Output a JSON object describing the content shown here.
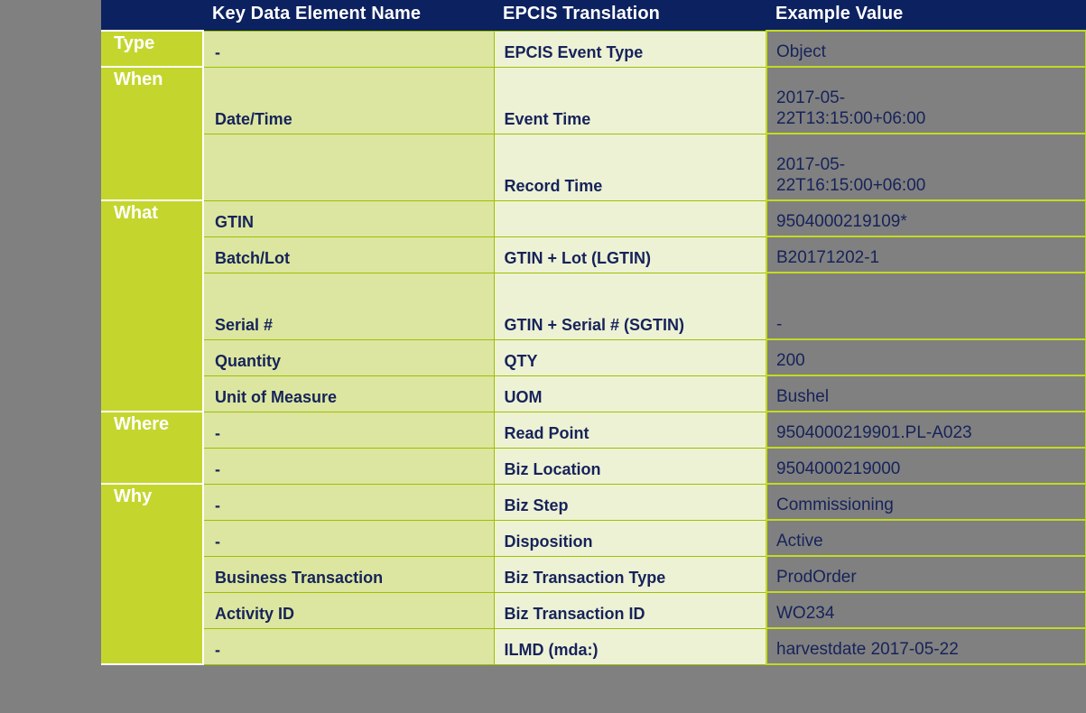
{
  "colors": {
    "page_background": "#808080",
    "header_background": "#0C2160",
    "header_text": "#FFFFFF",
    "section_background": "#C4D62E",
    "section_text": "#FFFFFF",
    "kde_background": "#DCE6A0",
    "epcis_background": "#EEF2D5",
    "body_text": "#16235A",
    "grid_line": "#9EC000",
    "value_border": "#C3DB1F"
  },
  "table": {
    "headers": {
      "section": "",
      "kde": "Key Data Element Name",
      "epcis": "EPCIS Translation",
      "value": "Example Value"
    },
    "sections": [
      {
        "label": "Type",
        "rowspan": 1
      },
      {
        "label": "When",
        "rowspan": 2
      },
      {
        "label": "What",
        "rowspan": 5
      },
      {
        "label": "Where",
        "rowspan": 2
      },
      {
        "label": "Why",
        "rowspan": 5
      }
    ],
    "rows": [
      {
        "section": "Type",
        "kde": "-",
        "epcis": "EPCIS Event Type",
        "value": "Object"
      },
      {
        "section": "When",
        "kde": "Date/Time",
        "epcis": "Event Time",
        "value": "2017-05-\n22T13:15:00+06:00"
      },
      {
        "section": "When",
        "kde": "",
        "epcis": "Record Time",
        "value": "2017-05-\n22T16:15:00+06:00"
      },
      {
        "section": "What",
        "kde": "GTIN",
        "epcis": "",
        "value": "9504000219109*"
      },
      {
        "section": "What",
        "kde": "Batch/Lot",
        "epcis": "GTIN + Lot (LGTIN)",
        "value": "B20171202-1"
      },
      {
        "section": "What",
        "kde": "Serial #",
        "epcis": "GTIN + Serial #\n(SGTIN)",
        "value": "-"
      },
      {
        "section": "What",
        "kde": "Quantity",
        "epcis": "QTY",
        "value": "200"
      },
      {
        "section": "What",
        "kde": "Unit of Measure",
        "epcis": "UOM",
        "value": "Bushel"
      },
      {
        "section": "Where",
        "kde": "-",
        "epcis": "Read Point",
        "value": "9504000219901.PL-A023"
      },
      {
        "section": "Where",
        "kde": "-",
        "epcis": "Biz Location",
        "value": "9504000219000"
      },
      {
        "section": "Why",
        "kde": "-",
        "epcis": "Biz Step",
        "value": "Commissioning"
      },
      {
        "section": "Why",
        "kde": "-",
        "epcis": "Disposition",
        "value": "Active"
      },
      {
        "section": "Why",
        "kde": "Business Transaction",
        "epcis": "Biz Transaction Type",
        "value": "ProdOrder"
      },
      {
        "section": "Why",
        "kde": "Activity ID",
        "epcis": "Biz Transaction ID",
        "value": "WO234"
      },
      {
        "section": "Why",
        "kde": "-",
        "epcis": "ILMD (mda:)",
        "value": "harvestdate 2017-05-22"
      }
    ]
  }
}
